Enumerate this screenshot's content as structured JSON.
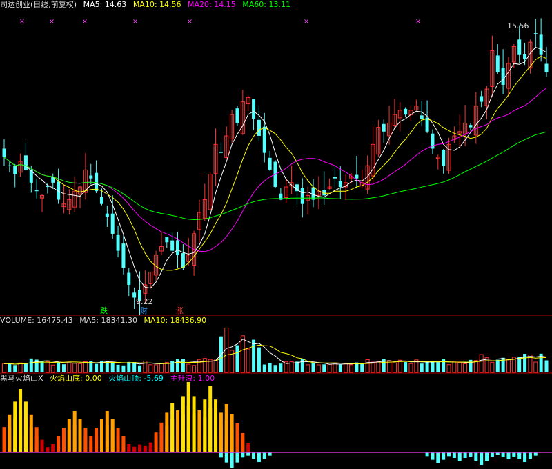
{
  "header": {
    "title": "司达创业(日线,前复权)",
    "ma5": "MA5: 14.63",
    "ma10": "MA10: 14.56",
    "ma20": "MA20: 14.15",
    "ma60": "MA60: 13.11",
    "colors": {
      "ma5": "#ffffff",
      "ma10": "#ffff00",
      "ma20": "#ff00ff",
      "ma60": "#00ff00"
    }
  },
  "price_panel": {
    "high_label": "15.56",
    "low_label": "9.22",
    "markers": [
      {
        "text": "跌",
        "color": "#00ff00"
      },
      {
        "text": "财",
        "color": "#3399ff"
      },
      {
        "text": "涨",
        "color": "#ff3333"
      }
    ]
  },
  "volume_panel": {
    "volume": "VOLUME: 16475.43",
    "ma5": "MA5: 18341.30",
    "ma10": "MA10: 18436.90"
  },
  "indicator_panel": {
    "name": "黑马火焰山X",
    "bottom": "火焰山底: 0.00",
    "top": "火焰山顶: -5.69",
    "wave": "主升浪: 1.00"
  },
  "chart_data": {
    "type": "candlestick",
    "ylim": [
      9.0,
      16.0
    ],
    "close": [
      12.6,
      12.4,
      12.2,
      12.5,
      12.3,
      12.0,
      11.8,
      11.7,
      11.9,
      12.0,
      11.6,
      11.5,
      11.6,
      11.8,
      11.9,
      12.3,
      12.1,
      11.8,
      11.5,
      11.2,
      10.8,
      10.4,
      10.0,
      9.6,
      9.3,
      9.22,
      9.6,
      9.9,
      10.3,
      10.5,
      10.6,
      10.4,
      10.3,
      10.0,
      10.3,
      10.8,
      11.3,
      11.6,
      12.2,
      12.9,
      12.7,
      13.1,
      13.6,
      13.4,
      13.9,
      14.0,
      13.5,
      13.1,
      12.7,
      12.3,
      11.9,
      11.6,
      11.9,
      12.0,
      11.8,
      11.5,
      11.7,
      11.6,
      11.8,
      11.7,
      11.9,
      12.1,
      11.9,
      12.0,
      12.2,
      12.1,
      12.0,
      12.4,
      12.9,
      13.3,
      13.2,
      13.4,
      13.6,
      13.7,
      13.6,
      13.7,
      13.8,
      13.5,
      13.2,
      12.8,
      12.6,
      12.4,
      12.9,
      13.1,
      13.2,
      13.4,
      13.3,
      13.8,
      13.9,
      14.2,
      15.1,
      14.6,
      14.3,
      14.8,
      15.2,
      15.0,
      14.9,
      15.3,
      15.5,
      15.0,
      14.6
    ],
    "ma_latest": {
      "MA5": 14.63,
      "MA10": 14.56,
      "MA20": 14.15,
      "MA60": 13.11
    },
    "volume_latest": {
      "VOLUME": 16475.43,
      "MA5": 18341.3,
      "MA10": 18436.9
    }
  }
}
